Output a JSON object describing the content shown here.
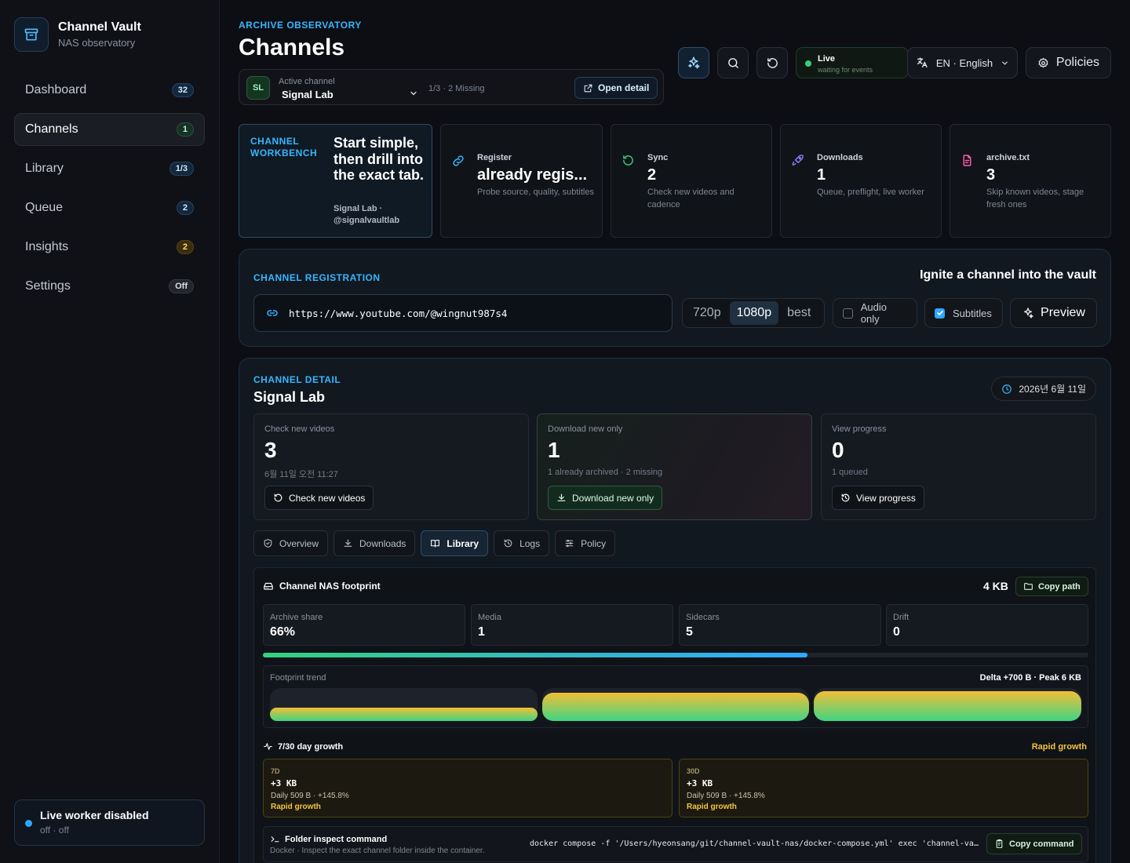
{
  "sidebar": {
    "brand_title": "Channel Vault",
    "brand_subtitle": "NAS observatory",
    "items": [
      {
        "label": "Dashboard",
        "badge": "32"
      },
      {
        "label": "Channels",
        "badge": "1"
      },
      {
        "label": "Library",
        "badge": "1/3"
      },
      {
        "label": "Queue",
        "badge": "2"
      },
      {
        "label": "Insights",
        "badge": "2"
      },
      {
        "label": "Settings",
        "badge": "Off"
      }
    ],
    "worker_title": "Live worker disabled",
    "worker_sub": "off · off"
  },
  "header": {
    "eyebrow": "ARCHIVE OBSERVATORY",
    "title": "Channels",
    "active_channel_label": "Active channel",
    "active_channel_initials": "SL",
    "active_channel_value": "Signal Lab",
    "missing": "1/3 · 2 Missing",
    "open_detail": "Open detail",
    "live_title": "Live",
    "live_sub": "waiting for events",
    "language": "EN · English",
    "policies": "Policies"
  },
  "workbench": {
    "eyebrow": "CHANNEL WORKBENCH",
    "title": "Start simple, then drill into the exact tab.",
    "sub": "Signal Lab · @signalvaultlab"
  },
  "stats": [
    {
      "label": "Register",
      "value": "already regis...",
      "sub": "Probe source, quality, subtitles",
      "icon": "link-icon",
      "color": "#38b6ff"
    },
    {
      "label": "Sync",
      "value": "2",
      "sub": "Check new videos and cadence",
      "icon": "refresh-icon",
      "color": "#34d27b"
    },
    {
      "label": "Downloads",
      "value": "1",
      "sub": "Queue, preflight, live worker",
      "icon": "rocket-icon",
      "color": "#8b7cff"
    },
    {
      "label": "archive.txt",
      "value": "3",
      "sub": "Skip known videos, stage fresh ones",
      "icon": "file-icon",
      "color": "#ff5fae"
    }
  ],
  "registration": {
    "eyebrow": "CHANNEL REGISTRATION",
    "tagline": "Ignite a channel into the vault",
    "url": "https://www.youtube.com/@wingnut987s4",
    "qualities": [
      "720p",
      "1080p",
      "best"
    ],
    "selected_quality": "1080p",
    "audio_only_label": "Audio only",
    "audio_only": false,
    "subtitles_label": "Subtitles",
    "subtitles": true,
    "preview_label": "Preview"
  },
  "detail": {
    "eyebrow": "CHANNEL DETAIL",
    "title": "Signal Lab",
    "date": "2026년 6월 11일",
    "actions": [
      {
        "label": "Check new videos",
        "value": "3",
        "sub": "6월 11일 오전 11:27",
        "button": "Check new videos"
      },
      {
        "label": "Download new only",
        "value": "1",
        "sub": "1 already archived · 2 missing",
        "button": "Download new only"
      },
      {
        "label": "View progress",
        "value": "0",
        "sub": "1 queued",
        "button": "View progress"
      }
    ],
    "tabs": [
      "Overview",
      "Downloads",
      "Library",
      "Logs",
      "Policy"
    ],
    "active_tab": "Library"
  },
  "footprint": {
    "title": "Channel NAS footprint",
    "size": "4 KB",
    "copy_path": "Copy path",
    "metrics": [
      {
        "label": "Archive share",
        "value": "66%"
      },
      {
        "label": "Media",
        "value": "1"
      },
      {
        "label": "Sidecars",
        "value": "5"
      },
      {
        "label": "Drift",
        "value": "0"
      }
    ],
    "archive_share_fraction": 0.66,
    "trend_label": "Footprint trend",
    "trend_meta": "Delta +700 B · Peak 6 KB",
    "trend_levels": [
      0.4,
      0.85,
      0.9
    ],
    "growth_title": "7/30 day growth",
    "growth_flag": "Rapid growth",
    "growth": [
      {
        "tag": "7D",
        "value": "+3 KB",
        "daily": "Daily 509 B · +145.8%",
        "status": "Rapid growth"
      },
      {
        "tag": "30D",
        "value": "+3 KB",
        "daily": "Daily 509 B · +145.8%",
        "status": "Rapid growth"
      }
    ],
    "cmd_title": "Folder inspect command",
    "cmd_sub": "Docker · Inspect the exact channel folder inside the container.",
    "cmd_text": "docker compose -f '/Users/hyeonsang/git/channel-vault-nas/docker-compose.yml' exec 'channel-vault'",
    "cmd_button": "Copy command"
  }
}
